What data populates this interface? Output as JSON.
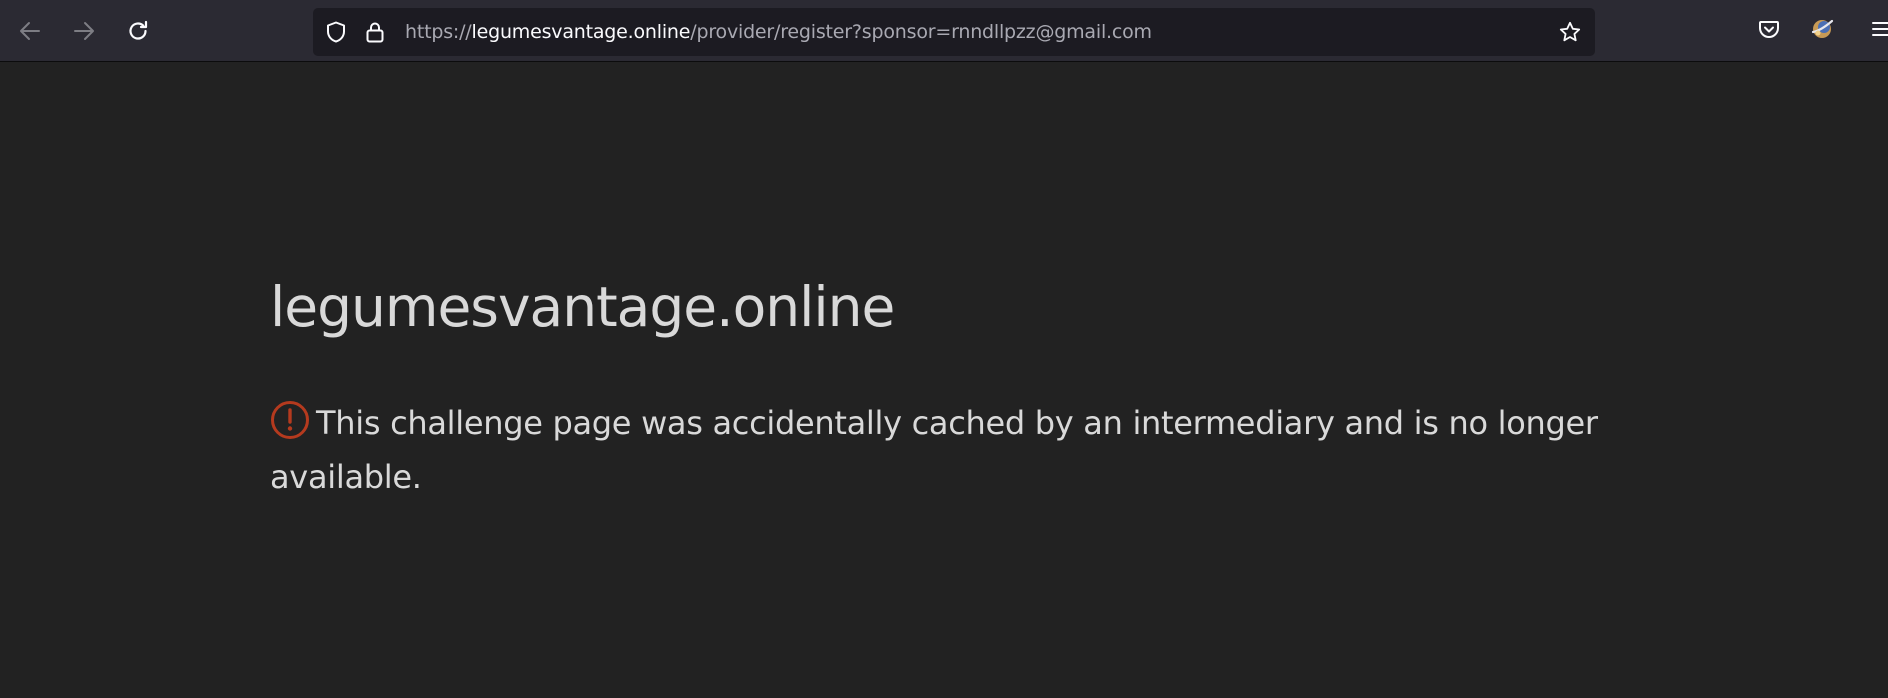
{
  "browser": {
    "url_scheme": "https://",
    "url_host": "legumesvantage.online",
    "url_path": "/provider/register?sponsor=rnndllpzz@gmail.com",
    "icons": {
      "back": "arrow-left-icon",
      "forward": "arrow-right-icon",
      "reload": "reload-icon",
      "tracking": "shield-icon",
      "security": "lock-icon",
      "bookmark": "star-icon",
      "pocket": "pocket-icon",
      "extension": "extension-icon",
      "menu": "hamburger-menu-icon"
    }
  },
  "page": {
    "title": "legumesvantage.online",
    "message": "This challenge page was accidentally cached by an intermediary and is no longer available.",
    "warning_icon": "exclamation-circle-icon"
  },
  "colors": {
    "page_background": "#222222",
    "toolbar_background": "#2b2a33",
    "urlbar_background": "#1c1b22",
    "text": "#d9d9d9",
    "warning": "#b53a1e"
  }
}
